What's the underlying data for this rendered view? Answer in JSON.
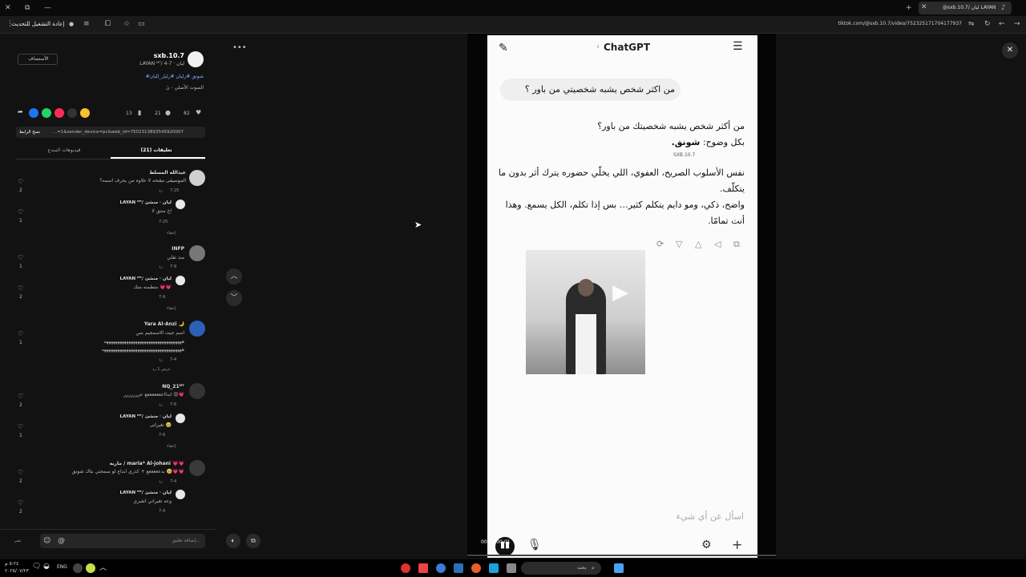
{
  "browser": {
    "tab_title": "@sxb.10.7/ ليان LAYAN",
    "reload_label": "إعادة التشغيل للتحديث",
    "url": "tiktok.com/@sxb.10.7/video/752325171704177937"
  },
  "post": {
    "username": "sxb.10.7",
    "subtitle": "LAYAN ᴹᵀ/ ليان · 7-4",
    "follow_label": "الأستضاف",
    "hashtags": "#شونق #رليان #رليل_لليان",
    "sound": "الصوت الأصلي - نَ",
    "likes": "82",
    "comments": "21",
    "saves": "13",
    "link": "...=1&sender_device=pc&web_id=7502313893545920007",
    "copy_link_label": "نسخ الرابط",
    "tab_comments": "تعليقات (21)",
    "tab_creator_videos": "فيديوهات المبدع"
  },
  "comments": [
    {
      "user": "عبدالله المسلط",
      "text": "الموسيقى مقتحه لا علاوه من يحرف اسمه؟",
      "date": "7-25",
      "reply_label": "رد",
      "likes": "2",
      "reply": {
        "user": "LAYAN ᴹᵀ/ ليان · منشئ",
        "text": "اخ منتق لا",
        "date": "7-25",
        "likes": "1"
      },
      "hide_label": "إخفاء"
    },
    {
      "user": "INFP",
      "text": "منذ تقلي",
      "date": "7-9",
      "reply_label": "رد",
      "likes": "1",
      "reply": {
        "user": "LAYAN ᴹᵀ/ ليان · منشئ",
        "text": "متطمنه منك 💗💗",
        "date": "7-9",
        "likes": "2"
      },
      "hide_label": "إخفاء"
    },
    {
      "user": "Yara Al-Anzi 🌙",
      "text": "اسم جيت الاسمجيم بس",
      "text2": "هههههههههههههههههههههههههههههههههههه",
      "text3": "ههههههههههههههههههههههههههههههههههههه",
      "date": "7-4",
      "reply_label": "رد",
      "likes": "1",
      "more_label": "عرض 1 رد"
    },
    {
      "user": "NQ_21ᴹᵀ",
      "text": "ابدااعععععععع عررررررر 😍💗",
      "date": "7-6",
      "reply_label": "رد",
      "likes": "2",
      "reply": {
        "user": "LAYAN ᴹᵀ/ ليان · منشئ",
        "text": "تغيرانى 🥹",
        "date": "7-6",
        "likes": "1"
      },
      "hide_label": "إخفاء"
    },
    {
      "user": "ماريه / maria* Al-johani 💗💗",
      "text": "بدعععععع + كذري ابداع لو سمحتي بتاك شونق 🥹💗💗",
      "date": "7-4",
      "reply_label": "رد",
      "likes": "2",
      "reply": {
        "user": "LAYAN ᴹᵀ/ ليان · منشئ",
        "text": "وعه تغيراني انقبري",
        "date": "7-4",
        "likes": "2"
      }
    }
  ],
  "comment_input": {
    "placeholder": "إضافة تعليق...",
    "post_label": "نشر"
  },
  "chat": {
    "app_title": "ChatGPT",
    "user_msg": "من اكثر شخص يشبه شخصيتي من باور ؟",
    "reply_line1": "من أكثر شخص يشبه شخصيتك من باور؟",
    "reply_line2_prefix": "بكل وضوح: ",
    "reply_line2_bold": "شونق.",
    "watermark": "SXB.10.7",
    "reply_para2": "نفس الأسلوب الصريح، العفوي، اللي يخلّي حضوره يترك أثر بدون ما يتكلّف.",
    "reply_para3": "واضح، ذكي، ومو دايم يتكلم كثير… بس إذا تكلم، الكل يسمع. وهذا أنت تمامًا.",
    "input_placeholder": "اسأل عن أي شيء",
    "time": "00:00/00:01"
  },
  "taskbar": {
    "search": "بحث",
    "lang": "ENG",
    "time": "٥:٢٤ م",
    "date": "٢٠٢٥/٠٧/٢٣"
  }
}
